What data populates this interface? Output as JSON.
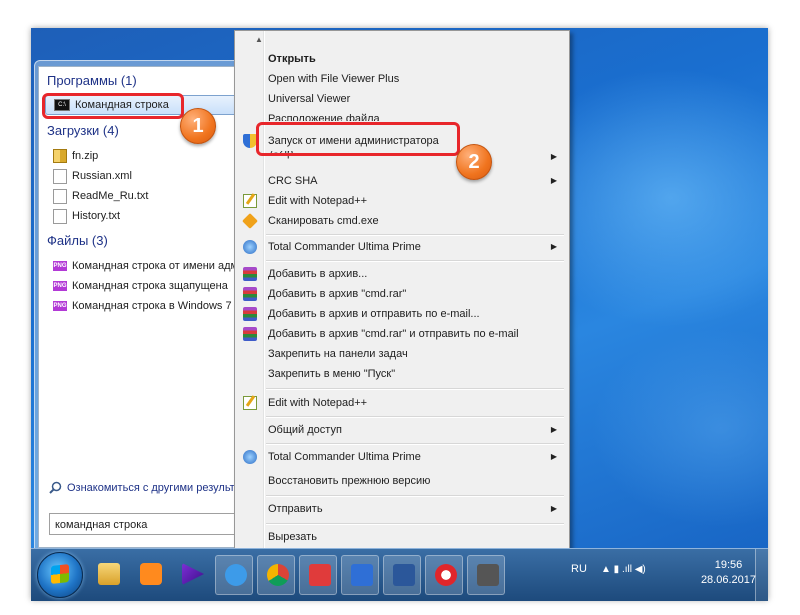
{
  "start_menu": {
    "programs": {
      "header": "Программы (1)",
      "items": [
        {
          "label": "Командная строка",
          "icon": "cmd-icon"
        }
      ]
    },
    "downloads": {
      "header": "Загрузки (4)",
      "items": [
        {
          "label": "fn.zip",
          "icon": "zip-icon"
        },
        {
          "label": "Russian.xml",
          "icon": "file-icon"
        },
        {
          "label": "ReadMe_Ru.txt",
          "icon": "file-icon"
        },
        {
          "label": "History.txt",
          "icon": "file-icon"
        }
      ]
    },
    "files": {
      "header": "Файлы (3)",
      "items": [
        {
          "label": "Командная строка от имени адм",
          "icon": "png-icon"
        },
        {
          "label": "Командная строка зщапущена",
          "icon": "png-icon"
        },
        {
          "label": "Командная строка в Windows 7",
          "icon": "png-icon"
        }
      ]
    },
    "see_more": "Ознакомиться с другими результа",
    "search_value": "командная строка"
  },
  "callouts": {
    "badge1": "1",
    "badge2": "2"
  },
  "context_menu": {
    "items": [
      {
        "label": "Открыть",
        "bold": true
      },
      {
        "label": "Open with File Viewer Plus"
      },
      {
        "label": "Universal Viewer"
      },
      {
        "label": "Расположение файла"
      },
      {
        "label": "Запуск от имени администратора",
        "icon": "shield-icon"
      },
      {
        "label": "7-Zip",
        "submenu": true
      },
      {
        "label": "CRC SHA",
        "submenu": true
      },
      {
        "label": "Edit with Notepad++",
        "icon": "notepadpp-icon"
      },
      {
        "label": "Сканировать cmd.exe",
        "icon": "antivirus-icon"
      },
      {
        "label": "Total Commander Ultima Prime",
        "icon": "total-commander-icon",
        "submenu": true
      },
      {
        "label": "Добавить в архив...",
        "icon": "winrar-icon"
      },
      {
        "label": "Добавить в архив \"cmd.rar\"",
        "icon": "winrar-icon"
      },
      {
        "label": "Добавить в архив и отправить по e-mail...",
        "icon": "winrar-icon"
      },
      {
        "label": "Добавить в архив \"cmd.rar\" и отправить по e-mail",
        "icon": "winrar-icon"
      },
      {
        "label": "Закрепить на панели задач"
      },
      {
        "label": "Закрепить в меню \"Пуск\""
      },
      {
        "label": "Edit with Notepad++",
        "icon": "notepadpp-icon"
      },
      {
        "label": "Общий доступ",
        "submenu": true
      },
      {
        "label": "Total Commander Ultima Prime",
        "icon": "total-commander-icon",
        "submenu": true
      },
      {
        "label": "Восстановить прежнюю версию"
      },
      {
        "label": "Отправить",
        "submenu": true
      },
      {
        "label": "Вырезать"
      }
    ],
    "submenu_arrow": "▶",
    "scroll_up": "▲",
    "scroll_down": "▼"
  },
  "taskbar": {
    "language": "RU",
    "time": "19:56",
    "date": "28.06.2017",
    "tray_symbols": "▲   ▮  .ıll  ◀)"
  }
}
